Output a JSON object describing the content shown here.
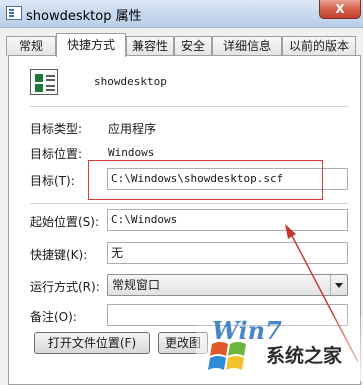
{
  "window": {
    "title": "showdesktop 属性",
    "close_label": "X"
  },
  "tabs": [
    {
      "label": "常规",
      "active": false
    },
    {
      "label": "快捷方式",
      "active": true
    },
    {
      "label": "兼容性",
      "active": false
    },
    {
      "label": "安全",
      "active": false
    },
    {
      "label": "详细信息",
      "active": false
    },
    {
      "label": "以前的版本",
      "active": false
    }
  ],
  "shortcut": {
    "name": "showdesktop",
    "target_type_label": "目标类型:",
    "target_type_value": "应用程序",
    "target_location_label": "目标位置:",
    "target_location_value": "Windows",
    "target_label": "目标(T):",
    "target_value": "C:\\Windows\\showdesktop.scf",
    "start_in_label": "起始位置(S):",
    "start_in_value": "C:\\Windows",
    "shortcut_key_label": "快捷键(K):",
    "shortcut_key_value": "无",
    "run_label": "运行方式(R):",
    "run_value": "常规窗口",
    "comment_label": "备注(O):",
    "comment_value": ""
  },
  "buttons": {
    "open_location": "打开文件位置(F)",
    "change_icon": "更改图"
  },
  "watermark": {
    "logo": "Win7",
    "site": "系统之家"
  },
  "colors": {
    "highlight": "#d23a3a",
    "arrow": "#c0392b"
  }
}
